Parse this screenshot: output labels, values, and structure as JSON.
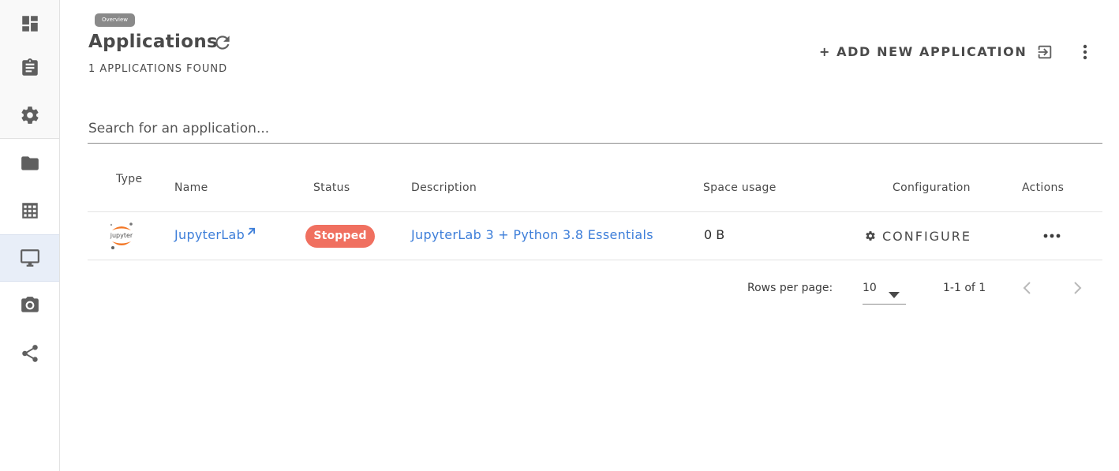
{
  "sidebar": {
    "items": [
      {
        "icon": "dashboard-icon"
      },
      {
        "icon": "clipboard-icon"
      },
      {
        "icon": "gear-icon"
      },
      {
        "icon": "folder-icon"
      },
      {
        "icon": "table-icon"
      },
      {
        "icon": "monitor-icon",
        "active": true
      },
      {
        "icon": "camera-icon"
      },
      {
        "icon": "share-icon"
      }
    ]
  },
  "header": {
    "tooltip": "Overview",
    "title": "Applications",
    "count_label": "1 APPLICATIONS FOUND",
    "add_label": "+ ADD NEW APPLICATION"
  },
  "search": {
    "placeholder": "Search for an application..."
  },
  "table": {
    "columns": {
      "type": "Type",
      "name": "Name",
      "status": "Status",
      "description": "Description",
      "space": "Space usage",
      "configuration": "Configuration",
      "actions": "Actions"
    },
    "rows": [
      {
        "type_icon": "jupyter-logo-icon",
        "logo_text": "jupyter",
        "name": "JupyterLab",
        "status": "Stopped",
        "description": "JupyterLab 3 + Python 3.8 Essentials",
        "space": "0 B",
        "configure_label": "CONFIGURE"
      }
    ]
  },
  "pagination": {
    "rows_label": "Rows per page:",
    "rows_value": "10",
    "range": "1-1 of 1"
  },
  "colors": {
    "accent_link": "#3d7ed9",
    "status_stopped": "#f07060",
    "active_nav": "#e8eef8",
    "jupyter_orange": "#f37726"
  }
}
